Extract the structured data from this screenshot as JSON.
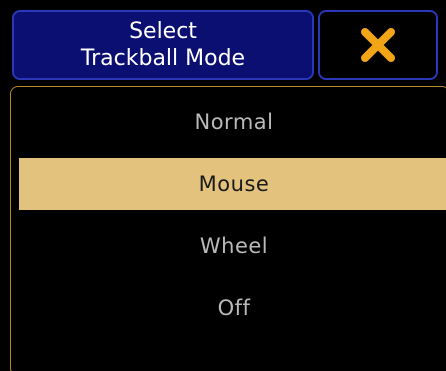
{
  "dialog": {
    "title_line1": "Select",
    "title_line2": "Trackball Mode",
    "close_icon": "close-x-icon"
  },
  "options": [
    {
      "label": "Normal",
      "selected": false
    },
    {
      "label": "Mouse",
      "selected": true
    },
    {
      "label": "Wheel",
      "selected": false
    },
    {
      "label": "Off",
      "selected": false
    }
  ],
  "colors": {
    "title_bg": "#0b0f72",
    "title_border": "#2a37b8",
    "panel_border": "#b48a2c",
    "selected_bg": "#e2c27d",
    "close_icon": "#f2a516",
    "option_text": "#b9b9b9"
  }
}
